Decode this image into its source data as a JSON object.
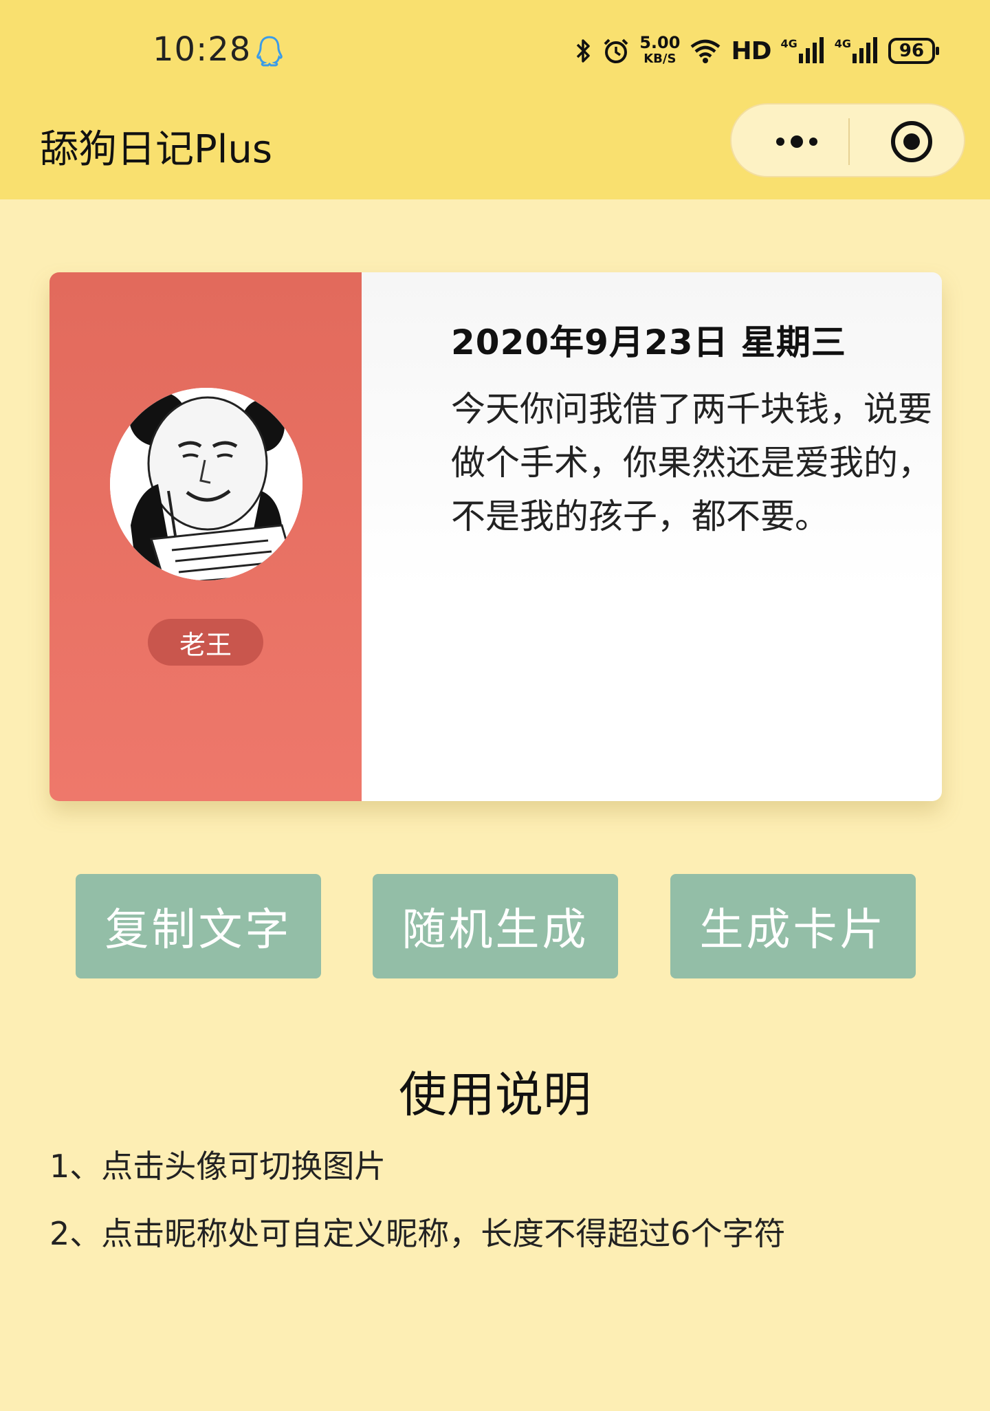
{
  "status_bar": {
    "time": "10:28",
    "network_speed_value": "5.00",
    "network_speed_unit": "KB/S",
    "hd_label": "HD",
    "signal_1_label": "4G",
    "signal_2_label": "4G",
    "battery": "96",
    "icons": [
      "qq-icon",
      "bluetooth-icon",
      "alarm-icon",
      "wifi-icon",
      "signal-icon",
      "signal-icon",
      "battery-icon"
    ]
  },
  "header": {
    "title": "舔狗日记Plus",
    "capsule_icons": [
      "more-icon",
      "close-target-icon"
    ]
  },
  "card": {
    "nickname": "老王",
    "date": "2020年9月23日 星期三",
    "text": "今天你问我借了两千块钱，说要做个手术，你果然还是爱我的，不是我的孩子，都不要。"
  },
  "buttons": {
    "copy": "复制文字",
    "random": "随机生成",
    "card": "生成卡片"
  },
  "instructions": {
    "title": "使用说明",
    "items": [
      "1、点击头像可切换图片",
      "2、点击昵称处可自定义昵称，长度不得超过6个字符"
    ]
  },
  "colors": {
    "header_bg": "#f9e06f",
    "page_bg": "#fdeeb4",
    "card_left": "#e8705f",
    "button": "#93bea7",
    "nickname_bg": "#c9564d"
  }
}
